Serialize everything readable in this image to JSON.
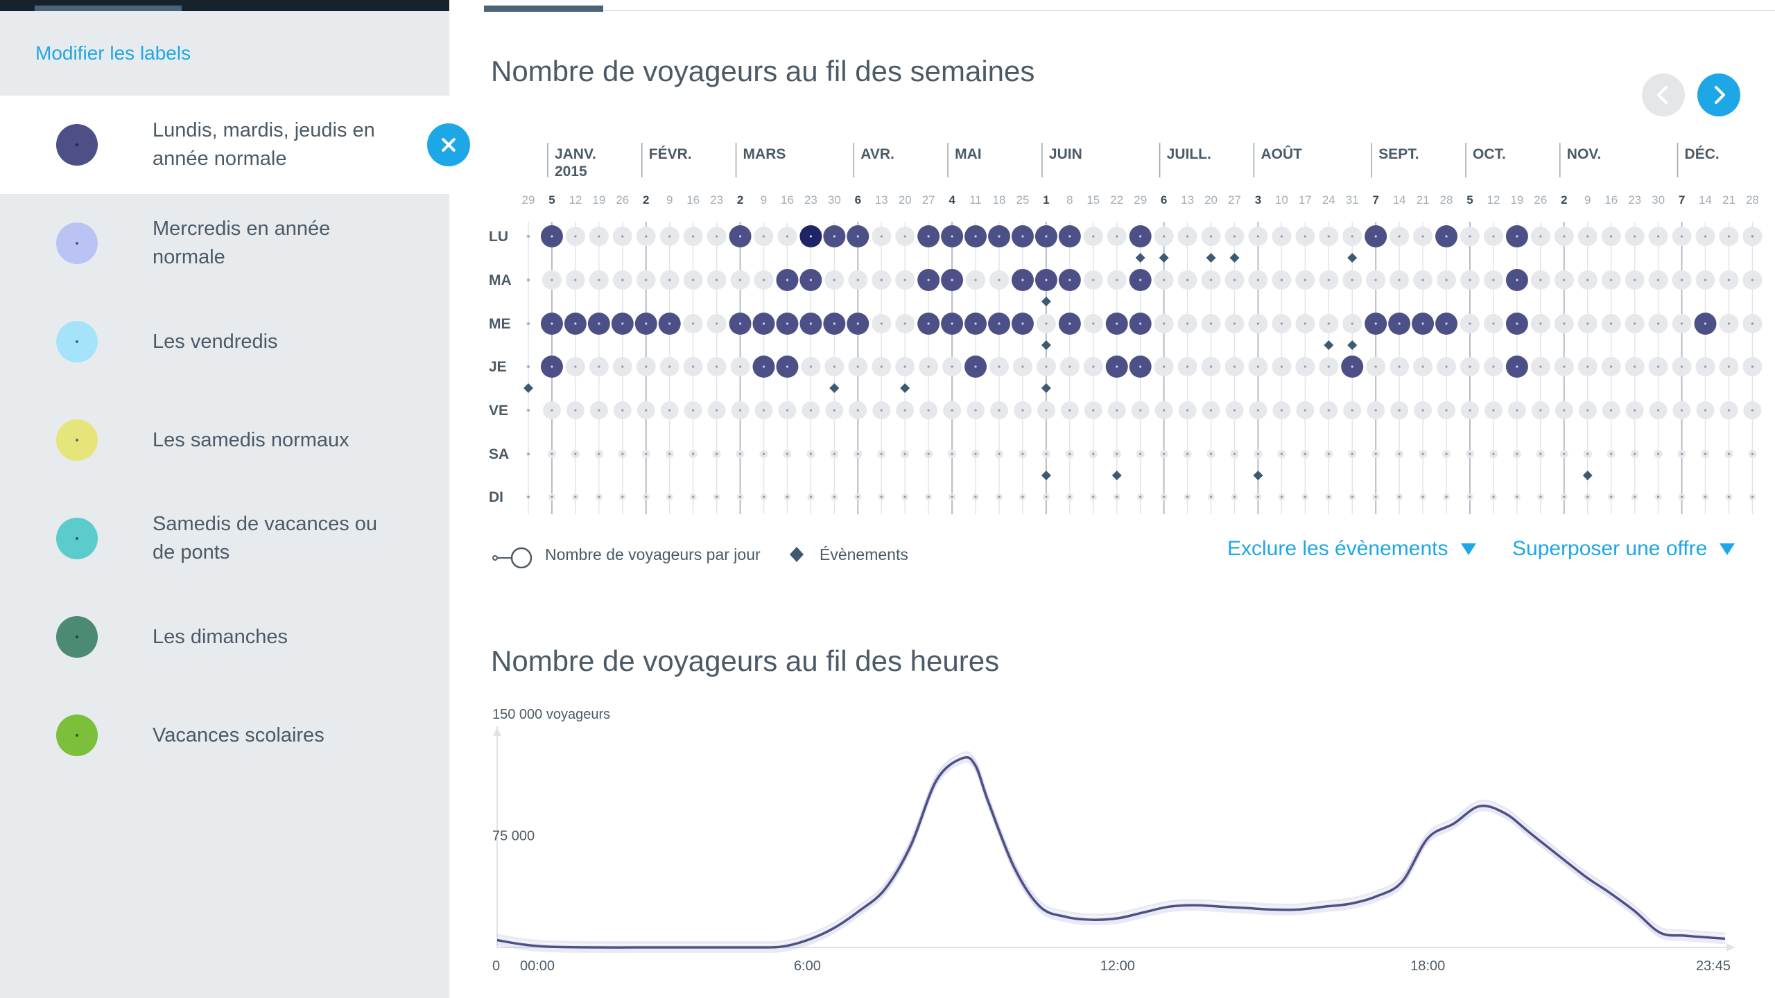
{
  "sidebar": {
    "header_link": "Modifier les labels",
    "items": [
      {
        "label": "Lundis, mardis, jeudis en année normale",
        "color": "#4d5086",
        "active": true
      },
      {
        "label": "Mercredis en année normale",
        "color": "#b9c4f4",
        "active": false
      },
      {
        "label": "Les vendredis",
        "color": "#a5e3fb",
        "active": false
      },
      {
        "label": "Les samedis normaux",
        "color": "#e6e57c",
        "active": false
      },
      {
        "label": "Samedis de vacances ou de ponts",
        "color": "#5bcbcb",
        "active": false
      },
      {
        "label": "Les dimanches",
        "color": "#4c8a73",
        "active": false
      },
      {
        "label": "Vacances scolaires",
        "color": "#7bbf3b",
        "active": false
      }
    ],
    "close_icon": "close-icon"
  },
  "weekly": {
    "title": "Nombre de voyageurs au fil des semaines",
    "prev_icon": "chevron-left-icon",
    "next_icon": "chevron-right-icon",
    "months": [
      "JANV.",
      "FÉVR.",
      "MARS",
      "AVR.",
      "MAI",
      "JUIN",
      "JUILL.",
      "AOÛT",
      "SEPT.",
      "OCT.",
      "NOV.",
      "DÉC."
    ],
    "year": "2015",
    "week_dates": [
      "29",
      "5",
      "12",
      "19",
      "26",
      "2",
      "9",
      "16",
      "23",
      "2",
      "9",
      "16",
      "23",
      "30",
      "6",
      "13",
      "20",
      "27",
      "4",
      "11",
      "18",
      "25",
      "1",
      "8",
      "15",
      "22",
      "29",
      "6",
      "13",
      "20",
      "27",
      "3",
      "10",
      "17",
      "24",
      "31",
      "7",
      "14",
      "21",
      "28",
      "5",
      "12",
      "19",
      "26",
      "2",
      "9",
      "16",
      "23",
      "30",
      "7",
      "14",
      "21",
      "28"
    ],
    "month_start_weeks": [
      1,
      5,
      9,
      14,
      18,
      22,
      27,
      31,
      36,
      40,
      44,
      49
    ],
    "day_labels": [
      "LU",
      "MA",
      "ME",
      "JE",
      "VE",
      "SA",
      "DI"
    ],
    "highlight_color": "#4d5086",
    "selected_color": "#1f2466",
    "inactive_color": "#e6e8ec",
    "highlighted": {
      "LU": [
        1,
        9,
        12,
        13,
        14,
        17,
        18,
        19,
        20,
        21,
        22,
        23,
        26,
        36,
        39,
        42
      ],
      "MA": [
        11,
        12,
        17,
        18,
        21,
        22,
        23,
        26,
        42
      ],
      "ME": [
        1,
        2,
        3,
        4,
        5,
        6,
        9,
        10,
        11,
        12,
        13,
        14,
        17,
        18,
        19,
        20,
        21,
        23,
        25,
        26,
        36,
        37,
        38,
        39,
        42,
        50
      ],
      "JE": [
        1,
        10,
        11,
        19,
        25,
        26,
        35,
        42
      ],
      "VE": [],
      "SA": [],
      "DI": []
    },
    "selected_cell": {
      "day": "LU",
      "week": 12
    },
    "events": [
      {
        "week": 0,
        "below": "JE"
      },
      {
        "week": 13,
        "below": "JE"
      },
      {
        "week": 16,
        "below": "JE"
      },
      {
        "week": 22,
        "below": "JE"
      },
      {
        "week": 22,
        "below": "MA"
      },
      {
        "week": 22,
        "below": "ME"
      },
      {
        "week": 26,
        "below": "LU"
      },
      {
        "week": 27,
        "below": "LU"
      },
      {
        "week": 29,
        "below": "LU"
      },
      {
        "week": 30,
        "below": "LU"
      },
      {
        "week": 35,
        "below": "LU"
      },
      {
        "week": 34,
        "below": "ME"
      },
      {
        "week": 35,
        "below": "ME"
      },
      {
        "week": 22,
        "below": "SA"
      },
      {
        "week": 25,
        "below": "SA"
      },
      {
        "week": 31,
        "below": "SA"
      },
      {
        "week": 45,
        "below": "SA"
      }
    ],
    "legend_size": "Nombre de voyageurs par jour",
    "legend_events": "Évènements",
    "exclude_dropdown": "Exclure les évènements",
    "overlay_dropdown": "Superposer une offre"
  },
  "hourly": {
    "title": "Nombre de voyageurs au fil des heures",
    "accent": "#1ea7e6"
  },
  "chart_data": {
    "type": "line",
    "title": "Nombre de voyageurs au fil des heures",
    "ylabel": "150 000 voyageurs",
    "y_ticks": [
      "0",
      "75 000"
    ],
    "x_ticks": [
      "00:00",
      "6:00",
      "12:00",
      "18:00",
      "23:45"
    ],
    "x_tick_hours": [
      0,
      6,
      12,
      18,
      23.75
    ],
    "ylim": [
      0,
      150000
    ],
    "xlim": [
      0,
      23.75
    ],
    "series": [
      {
        "values": [
          [
            0,
            5000
          ],
          [
            0.5,
            2000
          ],
          [
            1,
            500
          ],
          [
            2,
            0
          ],
          [
            3,
            0
          ],
          [
            4,
            0
          ],
          [
            5,
            0
          ],
          [
            5.5,
            500
          ],
          [
            6,
            5000
          ],
          [
            6.5,
            13000
          ],
          [
            7,
            25000
          ],
          [
            7.5,
            40000
          ],
          [
            8,
            70000
          ],
          [
            8.5,
            115000
          ],
          [
            9,
            130000
          ],
          [
            9.25,
            125000
          ],
          [
            9.5,
            100000
          ],
          [
            10,
            55000
          ],
          [
            10.5,
            28000
          ],
          [
            11,
            21000
          ],
          [
            11.5,
            19000
          ],
          [
            12,
            20000
          ],
          [
            12.5,
            24000
          ],
          [
            13,
            28000
          ],
          [
            13.5,
            29000
          ],
          [
            14,
            28000
          ],
          [
            14.5,
            27000
          ],
          [
            15,
            26000
          ],
          [
            15.5,
            26000
          ],
          [
            16,
            28000
          ],
          [
            16.5,
            30000
          ],
          [
            17,
            35000
          ],
          [
            17.5,
            45000
          ],
          [
            18,
            75000
          ],
          [
            18.5,
            85000
          ],
          [
            19,
            97000
          ],
          [
            19.5,
            92000
          ],
          [
            20,
            78000
          ],
          [
            21,
            50000
          ],
          [
            21.5,
            38000
          ],
          [
            22,
            25000
          ],
          [
            22.5,
            10000
          ],
          [
            23,
            8000
          ],
          [
            23.75,
            6000
          ]
        ]
      }
    ]
  }
}
